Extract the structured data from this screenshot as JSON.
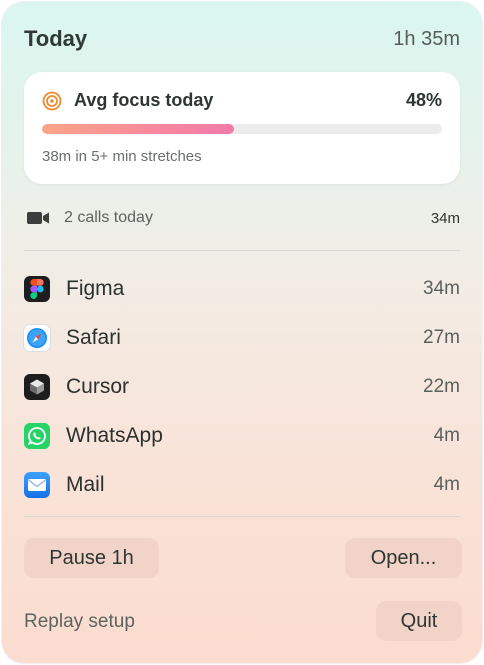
{
  "header": {
    "title": "Today",
    "total": "1h 35m"
  },
  "focus": {
    "label": "Avg focus today",
    "percent_text": "48%",
    "percent_value": 0.48,
    "subtitle": "38m in 5+ min stretches",
    "icon": "target-icon",
    "gradient": [
      "#f9a587",
      "#f07aa8"
    ]
  },
  "calls": {
    "label": "2 calls today",
    "time": "34m",
    "icon": "video-camera-icon"
  },
  "apps": [
    {
      "name": "Figma",
      "time": "34m",
      "icon": "figma-icon"
    },
    {
      "name": "Safari",
      "time": "27m",
      "icon": "safari-icon"
    },
    {
      "name": "Cursor",
      "time": "22m",
      "icon": "cursor-icon"
    },
    {
      "name": "WhatsApp",
      "time": "4m",
      "icon": "whatsapp-icon"
    },
    {
      "name": "Mail",
      "time": "4m",
      "icon": "mail-icon"
    }
  ],
  "actions": {
    "pause": "Pause 1h",
    "open": "Open...",
    "replay": "Replay setup",
    "quit": "Quit"
  },
  "colors": {
    "button_bg": "#f2d3c8",
    "accent_orange": "#f0892e"
  }
}
